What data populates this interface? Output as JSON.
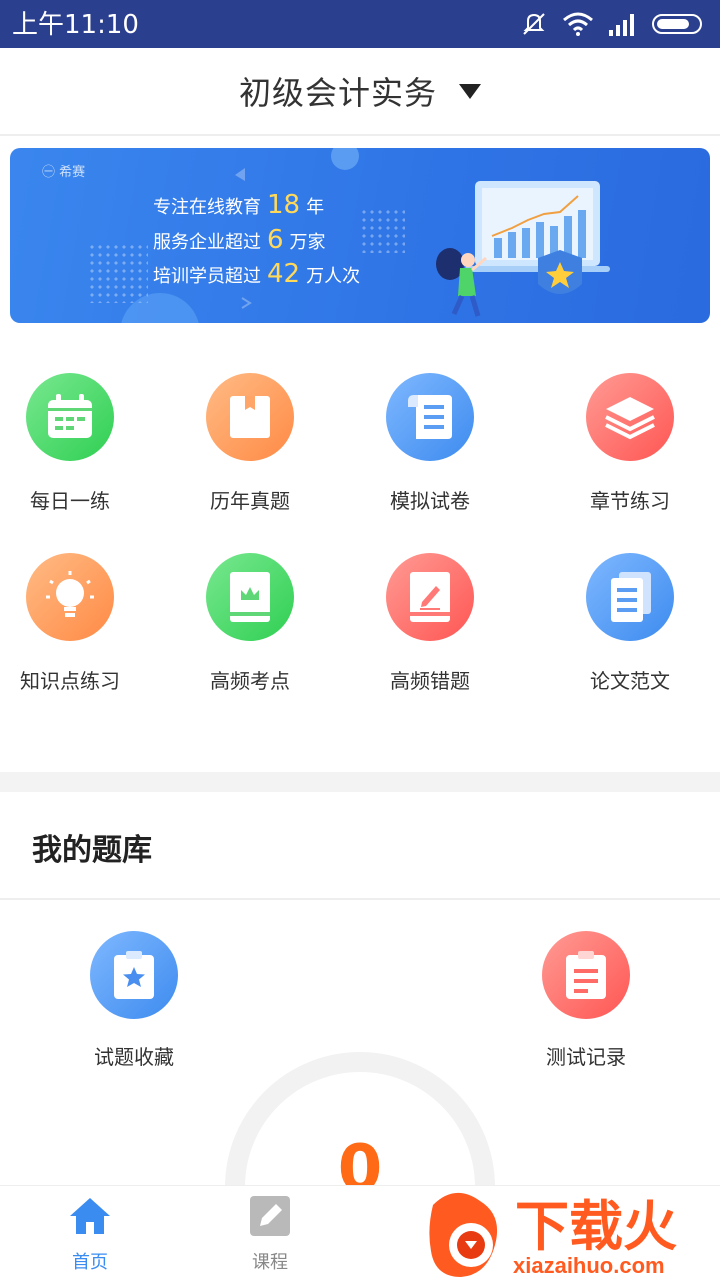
{
  "status_bar": {
    "time": "上午11:10"
  },
  "header": {
    "title": "初级会计实务"
  },
  "banner": {
    "logo": "希赛",
    "line1": {
      "prefix": "专注在线教育",
      "num": "18",
      "suffix": "年"
    },
    "line2": {
      "prefix": "服务企业超过",
      "num": "6",
      "suffix": "万家"
    },
    "line3": {
      "prefix": "培训学员超过",
      "num": "42",
      "suffix": "万人次"
    }
  },
  "grid": [
    {
      "label": "每日一练",
      "icon": "calendar-icon",
      "color": "#4fd46a"
    },
    {
      "label": "历年真题",
      "icon": "box-icon",
      "color": "#ff9b5e"
    },
    {
      "label": "模拟试卷",
      "icon": "scroll-icon",
      "color": "#4a9cf5"
    },
    {
      "label": "章节练习",
      "icon": "layers-icon",
      "color": "#ff6f6c"
    },
    {
      "label": "知识点练习",
      "icon": "lightbulb-icon",
      "color": "#ff9b5e"
    },
    {
      "label": "高频考点",
      "icon": "book-crown-icon",
      "color": "#4fd46a"
    },
    {
      "label": "高频错题",
      "icon": "book-pen-icon",
      "color": "#ff6f6c"
    },
    {
      "label": "论文范文",
      "icon": "documents-icon",
      "color": "#4a9cf5"
    }
  ],
  "my_bank": {
    "title": "我的题库",
    "items": [
      {
        "label": "试题收藏",
        "icon": "star-clipboard-icon",
        "color": "#4a9cf5"
      },
      {
        "label": "测试记录",
        "icon": "record-clipboard-icon",
        "color": "#ff6f6c"
      }
    ],
    "gauge_value": "0"
  },
  "tabbar": [
    {
      "label": "首页",
      "icon": "home-icon",
      "active": true
    },
    {
      "label": "课程",
      "icon": "edit-icon",
      "active": false
    }
  ],
  "watermark": {
    "title": "下载火",
    "url": "xiazaihuo.com"
  },
  "colors": {
    "status_bar": "#2b3f8f",
    "accent_blue": "#3b8cf0",
    "banner_highlight": "#ffd95a",
    "gauge_number": "#ff6a16"
  }
}
